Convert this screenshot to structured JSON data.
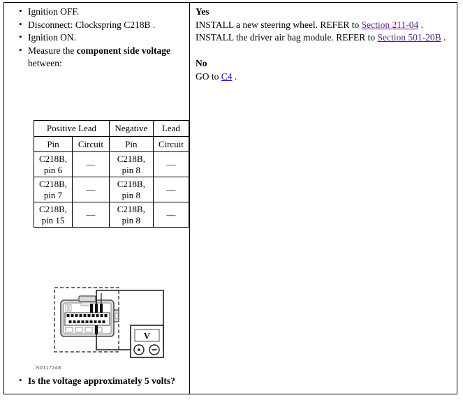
{
  "left_column": {
    "steps": [
      {
        "parts": [
          {
            "text": "Ignition OFF.",
            "style": "normal"
          }
        ]
      },
      {
        "parts": [
          {
            "text": "Disconnect: Clockspring C218B .",
            "style": "normal"
          }
        ]
      },
      {
        "parts": [
          {
            "text": "Ignition ON.",
            "style": "normal"
          }
        ]
      },
      {
        "parts": [
          {
            "text": "Measure the ",
            "style": "normal"
          },
          {
            "text": "component side voltage",
            "style": "bold"
          },
          {
            "text": " between:",
            "style": "normal"
          }
        ]
      }
    ],
    "table": {
      "group_headers": [
        {
          "label": "Positive Lead",
          "colspan": 2
        },
        {
          "label": "Negative",
          "colspan": 1
        },
        {
          "label": "Lead",
          "colspan": 1
        }
      ],
      "column_headers": [
        "Pin",
        "Circuit",
        "Pin",
        "Circuit"
      ],
      "rows": [
        [
          "C218B,\npin 6",
          "—",
          "C218B,\npin 8",
          "—"
        ],
        [
          "C218B,\npin 7",
          "—",
          "C218B,\npin 8",
          "—"
        ],
        [
          "C218B,\npin 15",
          "—",
          "C218B,\npin 8",
          "—"
        ]
      ]
    },
    "figure": {
      "id_label": "N0117248",
      "meter_display": "V",
      "meter_jack_positive": "+",
      "meter_jack_negative": "−",
      "connector_top_pin_count": 10,
      "connector_bottom_pin_count": 9
    },
    "question": "Is the voltage approximately 5 volts?"
  },
  "right_column": {
    "yes_label": "Yes",
    "yes_lines": [
      {
        "parts": [
          {
            "text": "INSTALL a new steering wheel. REFER to ",
            "style": "normal"
          },
          {
            "text": "Section 211-04",
            "style": "link"
          },
          {
            "text": " .",
            "style": "normal"
          }
        ]
      },
      {
        "parts": [
          {
            "text": "INSTALL the driver air bag module. REFER to ",
            "style": "normal"
          },
          {
            "text": "Section 501-20B",
            "style": "link"
          },
          {
            "text": " .",
            "style": "normal"
          }
        ]
      }
    ],
    "no_label": "No",
    "no_lines": [
      {
        "parts": [
          {
            "text": "GO to ",
            "style": "normal"
          },
          {
            "text": "C4",
            "style": "link-blue"
          },
          {
            "text": " .",
            "style": "normal"
          }
        ]
      }
    ]
  },
  "colors": {
    "link_visited": "#551a8b",
    "link_blue": "#1111cc",
    "border": "#000000",
    "text": "#000000",
    "figure_line": "#1a1a1a",
    "figure_fill": "#d9d9d9"
  }
}
